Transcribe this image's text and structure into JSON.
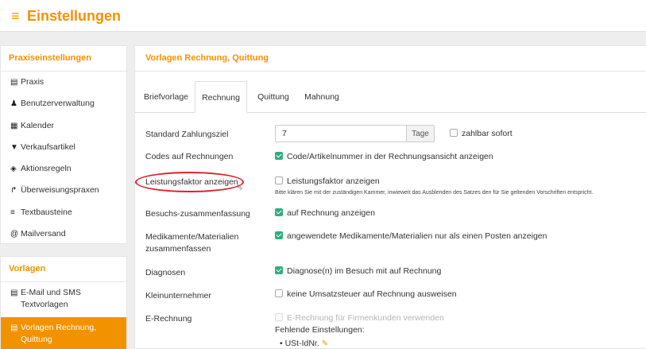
{
  "header": {
    "menu_icon": "≡",
    "title": "Einstellungen"
  },
  "sidebar": {
    "section1_title": "Praxiseinstellungen",
    "items": [
      {
        "icon": "▤",
        "label": "Praxis"
      },
      {
        "icon": "♟",
        "label": "Benutzerverwaltung"
      },
      {
        "icon": "▦",
        "label": "Kalender"
      },
      {
        "icon": "▼",
        "label": "Verkaufsartikel"
      },
      {
        "icon": "◈",
        "label": "Aktionsregeln"
      },
      {
        "icon": "↱",
        "label": "Überweisungspraxen"
      },
      {
        "icon": "≡",
        "label": "Textbausteine"
      },
      {
        "icon": "@",
        "label": "Mailversand"
      }
    ],
    "section2_title": "Vorlagen",
    "items2": [
      {
        "icon": "▤",
        "label_line1": "E-Mail und SMS",
        "label_line2": "Textvorlagen"
      },
      {
        "icon": "▤",
        "label_line1": "Vorlagen Rechnung,",
        "label_line2": "Quittung",
        "active": true
      }
    ]
  },
  "main": {
    "title": "Vorlagen Rechnung, Quittung",
    "tabs": [
      "Briefvorlage",
      "Rechnung",
      "Quittung",
      "Mahnung"
    ],
    "active_tab": "Rechnung",
    "settings": {
      "zahlungsziel": {
        "label": "Standard Zahlungsziel",
        "value": "7",
        "unit": "Tage",
        "checkbox_label": "zahlbar sofort",
        "checked": false
      },
      "codes": {
        "label": "Codes auf Rechnungen",
        "checkbox_label": "Code/Artikelnummer in der Rechnungsansicht anzeigen",
        "checked": true
      },
      "leistungsfaktor": {
        "label": "Leistungsfaktor anzeigen",
        "checkbox_label": "Leistungsfaktor anzeigen",
        "checked": false,
        "hint": "Bitte klären Sie mit der zuständigen Kammer, inwieweit das Ausblenden des Satzes den für Sie geltenden Vorschriften entspricht."
      },
      "besuch": {
        "label": "Besuchs-zusammenfassung",
        "checkbox_label": "auf Rechnung anzeigen",
        "checked": true
      },
      "medikamente": {
        "label_line1": "Medikamente/Materialien",
        "label_line2": "zusammenfassen",
        "checkbox_label": "angewendete Medikamente/Materialien nur als einen Posten anzeigen",
        "checked": true
      },
      "diagnosen": {
        "label": "Diagnosen",
        "checkbox_label": "Diagnose(n) im Besuch mit auf Rechnung",
        "checked": true
      },
      "kleinunternehmer": {
        "label": "Kleinunternehmer",
        "checkbox_label": "keine Umsatzsteuer auf Rechnung ausweisen",
        "checked": false
      },
      "erechnung": {
        "label": "E-Rechnung",
        "checkbox_label": "E-Rechnung für Firmenkunden verwenden",
        "checked": false,
        "disabled": true,
        "missing_title": "Fehlende Einstellungen:",
        "missing_items": [
          "USt-IdNr."
        ]
      }
    }
  },
  "colors": {
    "accent": "#f39200",
    "check": "#2eaf7d",
    "annotation": "#d9232d"
  }
}
